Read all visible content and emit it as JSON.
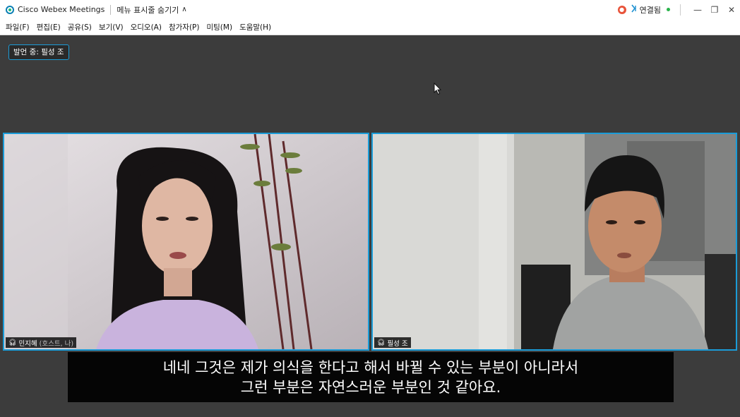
{
  "titlebar": {
    "app_title": "Cisco Webex Meetings",
    "hide_menu_label": "메뉴 표시줄 숨기기",
    "connection_label": "연결됨"
  },
  "menubar": {
    "items": [
      {
        "label": "파일(F)"
      },
      {
        "label": "편집(E)"
      },
      {
        "label": "공유(S)"
      },
      {
        "label": "보기(V)"
      },
      {
        "label": "오디오(A)"
      },
      {
        "label": "참가자(P)"
      },
      {
        "label": "미팅(M)"
      },
      {
        "label": "도움말(H)"
      }
    ]
  },
  "speaker": {
    "label": "발언 중: 필성 조"
  },
  "participants": [
    {
      "name": "민지혜",
      "role": "(호스트, 나)"
    },
    {
      "name": "필성 조",
      "role": ""
    }
  ],
  "subtitle": {
    "line1": "네네 그것은 제가 의식을 한다고 해서 바뀔 수 있는 부분이 아니라서",
    "line2": "그런 부분은 자연스러운 부분인 것 같아요."
  },
  "colors": {
    "accent": "#1b9cd8",
    "stage_bg": "#3c3c3c",
    "recording": "#e8533a",
    "connected": "#29b34a"
  },
  "icons": {
    "app": "webex-logo-icon",
    "recording": "recording-icon",
    "connection": "connection-icon",
    "audio": "headset-icon"
  }
}
